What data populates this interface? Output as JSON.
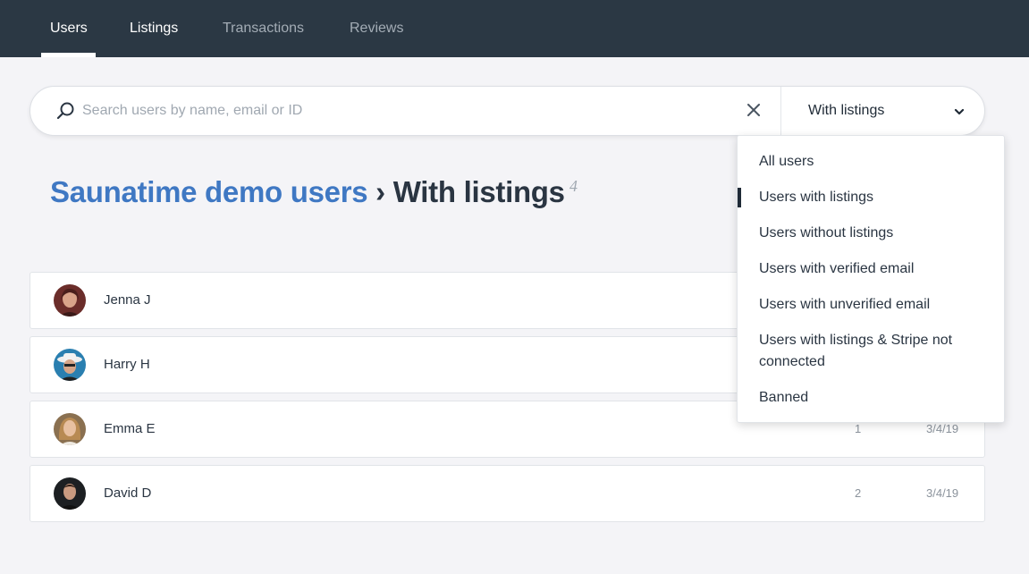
{
  "nav": {
    "tabs": [
      {
        "label": "Users",
        "active": true
      },
      {
        "label": "Listings",
        "active": false
      },
      {
        "label": "Transactions",
        "active": false
      },
      {
        "label": "Reviews",
        "active": false
      }
    ]
  },
  "search": {
    "value": "",
    "placeholder": "Search users by name, email or ID",
    "filter_selected": "With listings"
  },
  "heading": {
    "crumb": "Saunatime demo users",
    "separator": "›",
    "current": "With listings",
    "count": "4"
  },
  "users": [
    {
      "name": "Jenna J",
      "listings": "",
      "date": ""
    },
    {
      "name": "Harry H",
      "listings": "",
      "date": ""
    },
    {
      "name": "Emma E",
      "listings": "1",
      "date": "3/4/19"
    },
    {
      "name": "David D",
      "listings": "2",
      "date": "3/4/19"
    }
  ],
  "filter_menu": {
    "selected_index": 1,
    "options": [
      "All users",
      "Users with listings",
      "Users without listings",
      "Users with verified email",
      "Users with unverified email",
      "Users with listings & Stripe not connected",
      "Banned"
    ]
  },
  "colors": {
    "nav_background": "#2b3844",
    "link_blue": "#3f78c3",
    "page_background": "#f4f4f7"
  },
  "icons": {
    "search": "search-icon",
    "clear": "close-icon",
    "dropdown": "chevron-down-icon"
  }
}
